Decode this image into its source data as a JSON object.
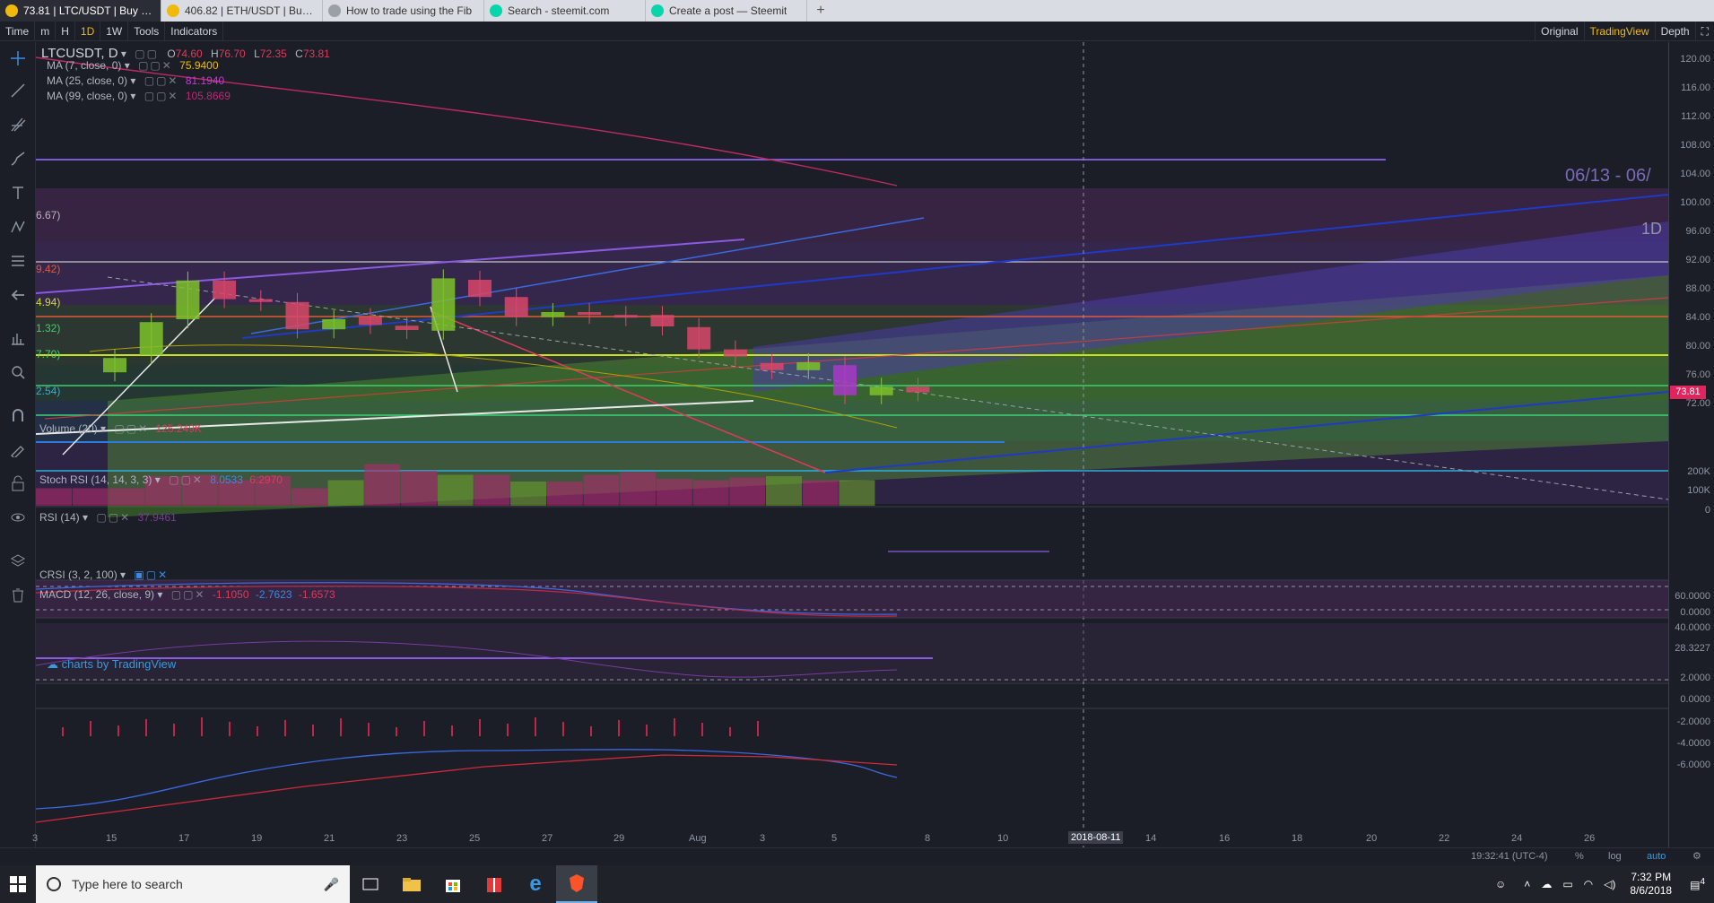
{
  "browser": {
    "tabs": [
      {
        "title": "73.81 | LTC/USDT | Buy Lite",
        "active": true,
        "fav_color": "#f0b90b"
      },
      {
        "title": "406.82 | ETH/USDT | Buy Et",
        "active": false,
        "fav_color": "#f0b90b"
      },
      {
        "title": "How to trade using the Fib",
        "active": false,
        "fav_color": "#9aa0a6"
      },
      {
        "title": "Search - steemit.com",
        "active": false,
        "fav_color": "#06d6a9"
      },
      {
        "title": "Create a post — Steemit",
        "active": false,
        "fav_color": "#06d6a9"
      }
    ],
    "new_tab": "+"
  },
  "toolbar": {
    "time": "Time",
    "minute": "m",
    "hour": "H",
    "day": "1D",
    "week": "1W",
    "tools": "Tools",
    "indicators": "Indicators",
    "original": "Original",
    "tradingview": "TradingView",
    "depth": "Depth"
  },
  "legend": {
    "symbol": "LTCUSDT, D",
    "o_label": "O",
    "o_value": "74.60",
    "h_label": "H",
    "h_value": "76.70",
    "l_label": "L",
    "l_value": "72.35",
    "c_label": "C",
    "c_value": "73.81",
    "ma7": "MA (7, close, 0)",
    "ma7_value": "75.9400",
    "ma25": "MA (25, close, 0)",
    "ma25_value": "81.1940",
    "ma99": "MA (99, close, 0)",
    "ma99_value": "105.8669"
  },
  "fib_labels": [
    "6.67)",
    "9.42)",
    "4.94)",
    "1.32)",
    "7.70)",
    "2.54)"
  ],
  "overlay": {
    "range_text": "06/13 - 06/",
    "interval_text": "1D"
  },
  "panes": {
    "volume": {
      "label": "Volume (20)",
      "value": "125.249K"
    },
    "stoch": {
      "label": "Stoch RSI (14, 14, 3, 3)",
      "v1": "8.0533",
      "v2": "6.2970"
    },
    "rsi": {
      "label": "RSI (14)",
      "value": "37.9461"
    },
    "crsi": {
      "label": "CRSI (3, 2, 100)"
    },
    "macd": {
      "label": "MACD (12, 26, close, 9)",
      "v1": "-1.1050",
      "v2": "-2.7623",
      "v3": "-1.6573"
    }
  },
  "price_axis": {
    "main": [
      "120.00",
      "116.00",
      "112.00",
      "108.00",
      "104.00",
      "100.00",
      "96.00",
      "92.00",
      "88.00",
      "84.00",
      "80.00",
      "76.00",
      "72.00"
    ],
    "current": "73.81",
    "volume": [
      "200K",
      "100K",
      "0"
    ],
    "stoch": [
      "0.0000"
    ],
    "rsi": [
      "60.0000",
      "40.0000",
      "28.3227"
    ],
    "macd": [
      "2.0000",
      "0.0000",
      "-2.0000",
      "-4.0000",
      "-6.0000"
    ]
  },
  "time_axis": {
    "labels": [
      "3",
      "15",
      "17",
      "19",
      "21",
      "23",
      "25",
      "27",
      "29",
      "Aug",
      "3",
      "5",
      "8",
      "10",
      "12",
      "14",
      "16",
      "18",
      "20",
      "22",
      "24",
      "26"
    ],
    "crosshair": "2018-08-11"
  },
  "bottom": {
    "time": "19:32:41 (UTC-4)",
    "pct": "%",
    "log": "log",
    "auto": "auto"
  },
  "watermark": "charts by TradingView",
  "taskbar": {
    "search_placeholder": "Type here to search",
    "time": "7:32 PM",
    "date": "8/6/2018",
    "notif_count": "4"
  },
  "chart_data": {
    "type": "candlestick",
    "title": "LTCUSDT, D",
    "ylim": [
      70,
      122
    ],
    "candles": [
      {
        "date": "Jul 15",
        "o": 76.6,
        "c": 78.6,
        "dir": "up"
      },
      {
        "date": "Jul 16",
        "o": 79.0,
        "c": 83.6,
        "dir": "up"
      },
      {
        "date": "Jul 17",
        "o": 84.0,
        "c": 89.4,
        "dir": "up"
      },
      {
        "date": "Jul 18",
        "o": 89.4,
        "c": 86.8,
        "dir": "down"
      },
      {
        "date": "Jul 19",
        "o": 86.8,
        "c": 86.4,
        "dir": "down"
      },
      {
        "date": "Jul 20",
        "o": 86.4,
        "c": 82.6,
        "dir": "down"
      },
      {
        "date": "Jul 21",
        "o": 82.6,
        "c": 84.0,
        "dir": "up"
      },
      {
        "date": "Jul 22",
        "o": 84.3,
        "c": 83.2,
        "dir": "down"
      },
      {
        "date": "Jul 23",
        "o": 83.1,
        "c": 82.5,
        "dir": "down"
      },
      {
        "date": "Jul 24",
        "o": 82.4,
        "c": 89.7,
        "dir": "up"
      },
      {
        "date": "Jul 25",
        "o": 89.5,
        "c": 87.1,
        "dir": "down"
      },
      {
        "date": "Jul 26",
        "o": 87.1,
        "c": 84.3,
        "dir": "down"
      },
      {
        "date": "Jul 27",
        "o": 84.3,
        "c": 85.0,
        "dir": "up"
      },
      {
        "date": "Jul 28",
        "o": 85.0,
        "c": 84.6,
        "dir": "down"
      },
      {
        "date": "Jul 29",
        "o": 84.6,
        "c": 84.3,
        "dir": "down"
      },
      {
        "date": "Jul 30",
        "o": 84.6,
        "c": 83.0,
        "dir": "down"
      },
      {
        "date": "Jul 31",
        "o": 82.9,
        "c": 79.8,
        "dir": "down"
      },
      {
        "date": "Aug 1",
        "o": 79.8,
        "c": 78.8,
        "dir": "down"
      },
      {
        "date": "Aug 2",
        "o": 77.9,
        "c": 76.9,
        "dir": "down"
      },
      {
        "date": "Aug 3",
        "o": 76.9,
        "c": 78.0,
        "dir": "up"
      },
      {
        "date": "Aug 4",
        "o": 77.6,
        "c": 73.4,
        "dir": "down"
      },
      {
        "date": "Aug 5",
        "o": 73.4,
        "c": 74.6,
        "dir": "up"
      },
      {
        "date": "Aug 6",
        "o": 74.6,
        "c": 73.81,
        "dir": "down"
      }
    ],
    "volume_k": [
      0,
      0,
      0,
      110,
      115,
      95,
      110,
      0,
      95,
      155,
      130,
      115,
      115,
      90,
      90,
      115,
      125,
      100,
      95,
      105,
      110,
      95,
      95
    ]
  }
}
